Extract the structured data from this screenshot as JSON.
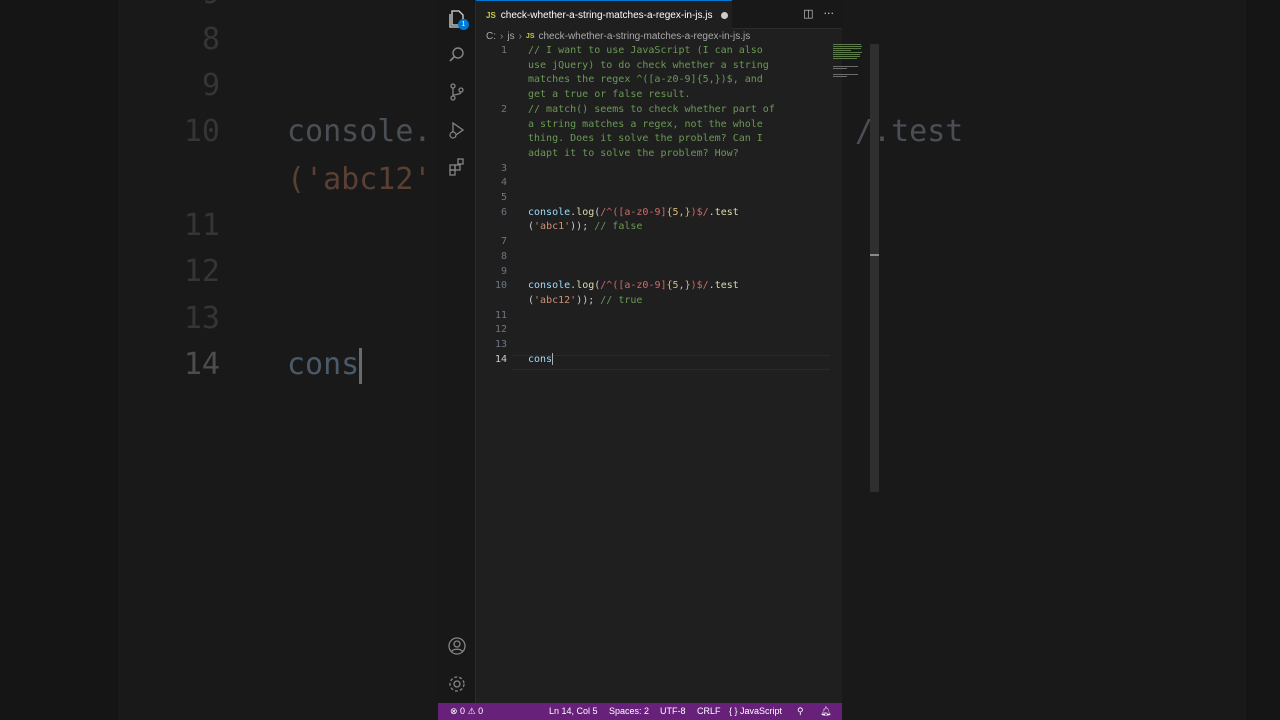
{
  "background": {
    "line_numbers": [
      "9",
      "8",
      "9",
      "10",
      "11",
      "12",
      "13",
      "14"
    ],
    "code_lines": [
      {
        "line": "10",
        "text_left": "console.",
        "text_right": "/.test"
      },
      {
        "line": "",
        "text_left": "('abc12'",
        "text_right": ""
      },
      {
        "line": "14",
        "text_left": "cons",
        "text_right": ""
      }
    ]
  },
  "activity_bar": {
    "explorer_badge": "1",
    "icons": [
      "files-icon",
      "search-icon",
      "source-control-icon",
      "run-debug-icon",
      "extensions-icon",
      "account-icon",
      "settings-gear-icon"
    ]
  },
  "tab": {
    "lang_badge": "JS",
    "filename": "check-whether-a-string-matches-a-regex-in-js.js"
  },
  "breadcrumb": {
    "drive": "C:",
    "folder": "js",
    "lang_badge": "JS",
    "file": "check-whether-a-string-matches-a-regex-in-js.js"
  },
  "editor": {
    "lines": [
      {
        "n": "1",
        "text": "// I want to use JavaScript (I can also"
      },
      {
        "n": "",
        "text": "use jQuery) to do check whether a string"
      },
      {
        "n": "",
        "text": "matches the regex ^([a-z0-9]{5,})$, and"
      },
      {
        "n": "",
        "text": "get a true or false result."
      },
      {
        "n": "2",
        "text": "// match() seems to check whether part of"
      },
      {
        "n": "",
        "text": "a string matches a regex, not the whole"
      },
      {
        "n": "",
        "text": "thing. Does it solve the problem? Can I"
      },
      {
        "n": "",
        "text": "adapt it to solve the problem? How?"
      },
      {
        "n": "3",
        "text": ""
      },
      {
        "n": "4",
        "text": ""
      },
      {
        "n": "5",
        "text": ""
      },
      {
        "n": "6",
        "text": "console.log(/^([a-z0-9]{5,})$/.test"
      },
      {
        "n": "",
        "text": "('abc1')); // false"
      },
      {
        "n": "7",
        "text": ""
      },
      {
        "n": "8",
        "text": ""
      },
      {
        "n": "9",
        "text": ""
      },
      {
        "n": "10",
        "text": "console.log(/^([a-z0-9]{5,})$/.test"
      },
      {
        "n": "",
        "text": "('abc12')); // true"
      },
      {
        "n": "11",
        "text": ""
      },
      {
        "n": "12",
        "text": ""
      },
      {
        "n": "13",
        "text": ""
      },
      {
        "n": "14",
        "text": "cons"
      }
    ],
    "active_line": "14"
  },
  "statusbar": {
    "errors": "0",
    "warnings": "0",
    "position": "Ln 14, Col 5",
    "spaces": "Spaces: 2",
    "encoding": "UTF-8",
    "eol": "CRLF",
    "language": "JavaScript",
    "language_icon": "{ }"
  },
  "colors": {
    "statusbar": "#68217a",
    "comment": "#6a9955",
    "regex": "#d16969",
    "string": "#ce9178",
    "identifier": "#9cdcfe",
    "function": "#dcdcaa",
    "accent": "#0078d4"
  }
}
